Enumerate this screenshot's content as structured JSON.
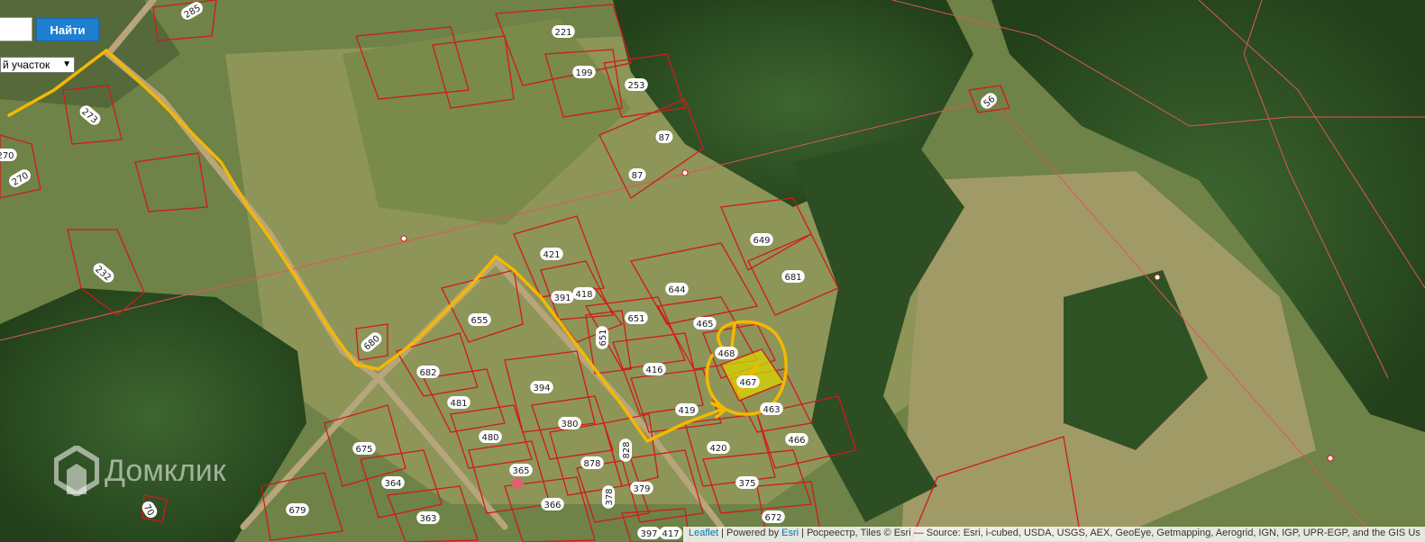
{
  "search": {
    "button_label": "Найти",
    "input_value": ""
  },
  "type_select": {
    "selected": "й участок"
  },
  "watermark": {
    "text": "Домклик"
  },
  "attribution": {
    "leaflet": "Leaflet",
    "sep1": " | Powered by ",
    "esri": "Esri",
    "rest": " | Росреестр, Tiles © Esri — Source: Esri, i-cubed, USDA, USGS, AEX, GeoEye, Getmapping, Aerogrid, IGN, IGP, UPR-EGP, and the GIS Us"
  },
  "colors": {
    "parcel_border": "#d11a1a",
    "route": "#f5b800",
    "highlight_fill": "#d8d600",
    "forest": "#2f4f22",
    "field": "#8f9a5c"
  },
  "parcels": [
    "285",
    "221",
    "199",
    "253",
    "87",
    "87",
    "273",
    "270",
    "270",
    "56",
    "232",
    "680",
    "649",
    "681",
    "421",
    "418",
    "391",
    "644",
    "651",
    "465",
    "651",
    "655",
    "682",
    "416",
    "468",
    "467",
    "481",
    "394",
    "419",
    "463",
    "480",
    "380",
    "878",
    "828",
    "420",
    "466",
    "675",
    "365",
    "364",
    "378",
    "379",
    "375",
    "679",
    "366",
    "363",
    "397",
    "417",
    "672",
    "70"
  ]
}
